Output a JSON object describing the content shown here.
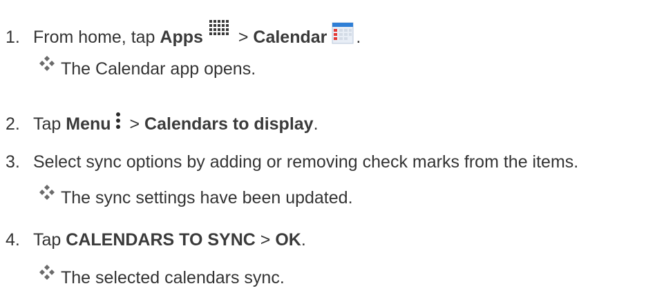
{
  "steps": [
    {
      "number": "1.",
      "text_1": "From home, tap ",
      "bold_1": "Apps",
      "separator": " > ",
      "bold_2": "Calendar",
      "end": "."
    },
    {
      "number": "2.",
      "text_1": "Tap ",
      "bold_1": "Menu",
      "separator": " > ",
      "bold_2": "Calendars to display",
      "end": "."
    },
    {
      "number": "3.",
      "text_1": "Select sync options by adding or removing check marks from the items."
    },
    {
      "number": "4.",
      "text_1": "Tap ",
      "bold_1": "CALENDARS TO SYNC",
      "separator": " > ",
      "bold_2": "OK",
      "end": "."
    }
  ],
  "results": [
    "The Calendar app opens.",
    "The sync settings have been updated.",
    "The selected calendars sync."
  ],
  "icons": {
    "apps": "apps-grid-icon",
    "calendar": "calendar-icon",
    "menu": "menu-dots-icon",
    "bullet": "diamond-bullet-icon"
  },
  "colors": {
    "text": "#333333",
    "bullet": "#6b6b6b",
    "calendar_red": "#e53935",
    "calendar_blue": "#2f7fd6"
  }
}
